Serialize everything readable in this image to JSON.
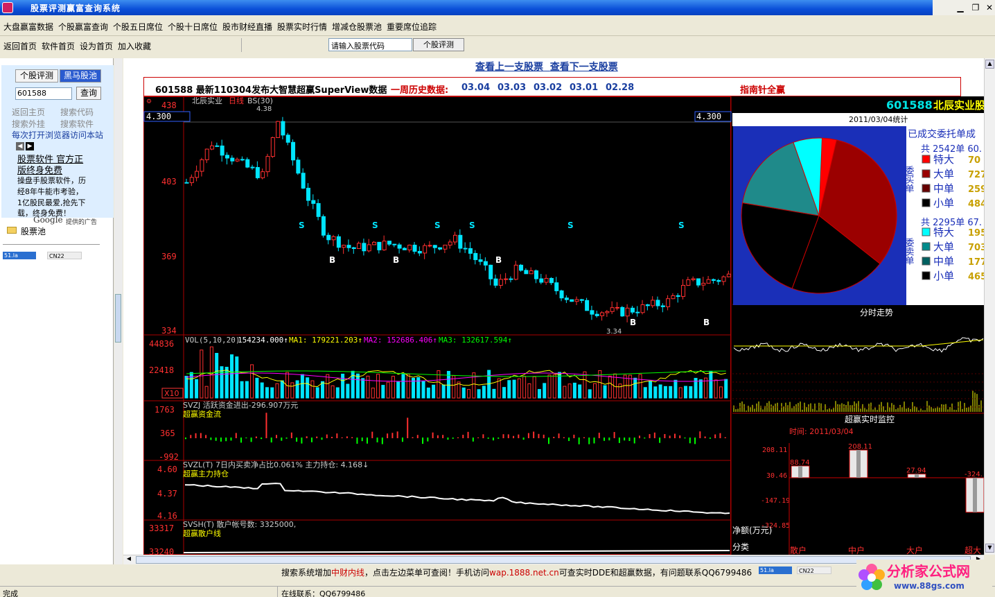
{
  "window": {
    "title": "股票评测赢富查询系统"
  },
  "menu": [
    "大盘赢富数据",
    "个股赢富查询",
    "个股五日席位",
    "个股十日席位",
    "股市财经直播",
    "股票实时行情",
    "增减仓股票池",
    "重要席位追踪"
  ],
  "toolbar": {
    "links": [
      "返回首页",
      "软件首页",
      "设为首页",
      "加入收藏"
    ],
    "code_placeholder": "请输入股票代码",
    "button": "个股评测"
  },
  "sidebar": {
    "tabs": [
      "个股评测",
      "黑马股池"
    ],
    "code_value": "601588",
    "query_btn": "查询",
    "links": [
      "返回主页",
      "搜索代码",
      "搜索外挂",
      "搜索软件"
    ],
    "notice": "每次打开浏览器访问本站",
    "ad_title1": "股票软件 官方正",
    "ad_title2": "版终身免费",
    "ad_lines": [
      "操盘手股票软件，历",
      "经8年牛能市考验，",
      "1亿股民最爱,抢先下",
      "载，终身免费！"
    ],
    "google": "Google",
    "google_tag": "提供的广告",
    "folder": "股票池",
    "badge1": "51.la",
    "badge2": "CN22"
  },
  "nav": {
    "prev": "查看上一支股票",
    "next": "查看下一支股票"
  },
  "info": {
    "headline": "601588 最新110304发布大智慧超赢SuperView数据",
    "history_label": "一周历史数据:",
    "dates": [
      "03.04",
      "03.03",
      "03.02",
      "03.01",
      "02.28"
    ],
    "guide": "指南针全赢"
  },
  "chart_data": {
    "type": "candlestick",
    "stock_name": "北辰实业",
    "period_label": "日线",
    "indicator": "BS(30)",
    "price_axis": [
      "438",
      "403",
      "369",
      "334"
    ],
    "price_high_marker": "4.38",
    "price_low_marker": "3.34",
    "current_price": "4.300",
    "vol_label": "VOL(5,10,20)",
    "vol_value": "154234.000↑",
    "ma1": "MA1: 179221.203↑",
    "ma2": "MA2: 152686.406↑",
    "ma3": "MA3: 132617.594↑",
    "vol_axis": [
      "44836",
      "22418"
    ],
    "vol_unit": "X10",
    "svzj_label": "SVZJ 活跃资金进出-296.907万元",
    "svzj_name": "超赢资金流",
    "svzj_axis": [
      "1763",
      "365",
      "-992"
    ],
    "svzl_label": "SVZL(T) 7日内买卖净占比0.061% 主力持仓: 4.168↓",
    "svzl_name": "超赢主力持仓",
    "svzl_axis": [
      "4.60",
      "4.37",
      "4.16"
    ],
    "svsh_label": "SVSH(T) 散户帐号数: 3325000,",
    "svsh_name": "超赢散户线",
    "svsh_axis": [
      "33317",
      "33240"
    ],
    "signals": [
      "B",
      "S"
    ],
    "ylim": [
      3.34,
      4.38
    ]
  },
  "right_panel": {
    "code": "601588",
    "name": "北辰实业股",
    "date_stat": "2011/03/04统计",
    "order_title": "已成交委托单成",
    "buy_total": "共 2542单 60.",
    "sell_total": "共 2295单 67.",
    "buy_side": "委买单",
    "sell_side": "委卖单",
    "buy_rows": [
      {
        "label": "特大",
        "val": "70",
        "color": "#ff0000"
      },
      {
        "label": "大单",
        "val": "727",
        "color": "#990000"
      },
      {
        "label": "中单",
        "val": "259",
        "color": "#660000"
      },
      {
        "label": "小单",
        "val": "484",
        "color": "#000000"
      }
    ],
    "sell_rows": [
      {
        "label": "特大",
        "val": "195",
        "color": "#00ffff"
      },
      {
        "label": "大单",
        "val": "703",
        "color": "#008b8b"
      },
      {
        "label": "中单",
        "val": "177",
        "color": "#006060"
      },
      {
        "label": "小单",
        "val": "465",
        "color": "#000000"
      }
    ],
    "pie": [
      {
        "v": 0.03,
        "c": "#ff0000"
      },
      {
        "v": 0.32,
        "c": "#9b0000"
      },
      {
        "v": 0.2,
        "c": "#000000"
      },
      {
        "v": 0.22,
        "c": "#000000"
      },
      {
        "v": 0.17,
        "c": "#1f8a8a"
      },
      {
        "v": 0.06,
        "c": "#00ffff"
      }
    ],
    "intraday_title": "分时走势",
    "monitor_title": "超赢实时监控",
    "monitor_time": "时间: 2011/03/04",
    "monitor_axis": [
      "208.11",
      "30.46",
      "-147.19",
      "-324.85"
    ],
    "monitor_bars": [
      {
        "label": "88.74",
        "v": 88.74
      },
      {
        "label": "208.11",
        "v": 208.11
      },
      {
        "label": "27.94",
        "v": 27.94
      },
      {
        "label": "-324.",
        "v": -324
      }
    ],
    "monitor_cats": [
      "散户",
      "中户",
      "大户",
      "超大"
    ],
    "net_label": "净额(万元)",
    "cat_label": "分类"
  },
  "footer": {
    "text1": "搜索系统增加",
    "text_red1": "中财内线",
    "text2": "，点击左边菜单可查阅！手机访问",
    "text_red2": "wap.1888.net.cn",
    "text3": "可查实时DDE和超赢数据，有问题联系QQ6799486",
    "logo_text": "分析家公式网",
    "logo_url": "www.88gs.com"
  },
  "status": {
    "left": "完成",
    "middle": "在线联系：QQ6799486"
  }
}
